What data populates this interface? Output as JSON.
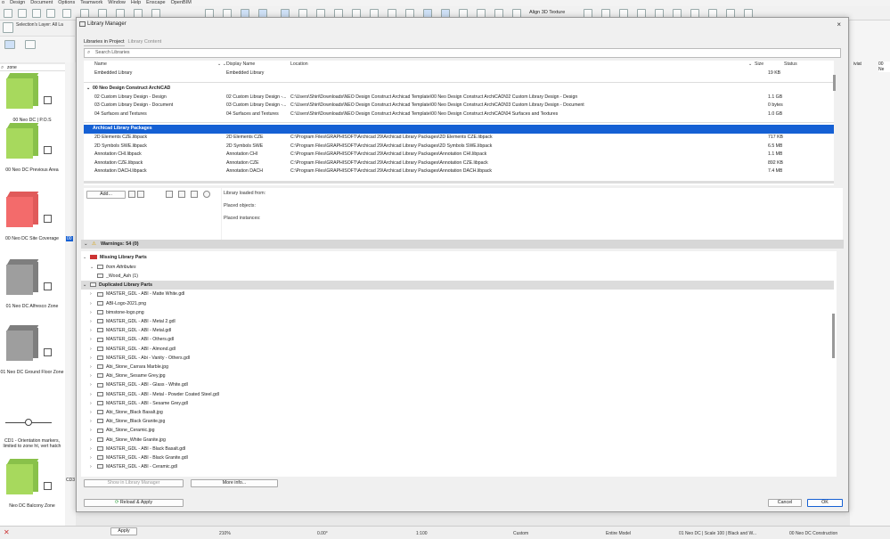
{
  "menu": [
    "o",
    "Design",
    "Document",
    "Options",
    "Teamwork",
    "Window",
    "Help",
    "Enscape",
    "OpenBIM"
  ],
  "toolbar": {
    "align_label": "Align 3D Texture"
  },
  "left": {
    "selection_label": "Selection's Layer:",
    "layer_label": "All La",
    "search_text": "zone",
    "items": [
      {
        "label": "00 Neo DC | P.O.S",
        "color": "#a7d95d",
        "side": "#89c14a"
      },
      {
        "label": "00 Neo DC Previous Area",
        "color": "#a7d95d",
        "side": "#89c14a"
      },
      {
        "label": "00 Neo DC Site Coverage",
        "color": "#f36b6b",
        "side": "#e05a5a"
      },
      {
        "label": "01 Neo DC Alfresco Zone",
        "color": "#9e9e9e",
        "side": "#7e7e7e"
      },
      {
        "label": "01 Neo DC Ground Floor Zone",
        "color": "#9e9e9e",
        "side": "#7e7e7e"
      },
      {
        "label": "CD1 - Orientation markers, limited to zone ht, vert hatch",
        "color": "",
        "side": ""
      },
      {
        "label": "Neo DC Balcony Zone",
        "color": "#a7d95d",
        "side": "#89c14a"
      }
    ],
    "mid_label": "CD3",
    "mid_num": "00"
  },
  "right": {
    "label1": "iviat",
    "label2": "00 Ne"
  },
  "dialog": {
    "title": "Library Manager",
    "close": "×",
    "tabs": [
      "Libraries in Project",
      "Library Content"
    ],
    "search_placeholder": "Search Libraries",
    "columns": {
      "name": "Name",
      "display": "Display Name",
      "location": "Location",
      "size": "Size",
      "status": "Status"
    },
    "rows": [
      {
        "name": "Embedded Library",
        "display": "Embedded Library",
        "location": "",
        "size": "19 KB",
        "style": ""
      },
      {
        "name": "",
        "display": "",
        "location": "",
        "size": "",
        "style": "gap"
      },
      {
        "name": "00 Neo Design Construct ArchiCAD",
        "display": "",
        "location": "",
        "size": "",
        "style": "bold"
      },
      {
        "name": "02 Custom Library Design - Design",
        "display": "02 Custom Library Design -...",
        "location": "C:\\Users\\Shiri\\Downloads\\NEO Design Construct Archicad Template\\00 Neo Design Construct ArchiCAD\\02 Custom Library Design - Design",
        "size": "1.1 GB",
        "style": ""
      },
      {
        "name": "03 Custom Library Design - Document",
        "display": "03 Custom Library Design -...",
        "location": "C:\\Users\\Shiri\\Downloads\\NEO Design Construct Archicad Template\\00 Neo Design Construct ArchiCAD\\03 Custom Library Design - Document",
        "size": "0 bytes",
        "style": ""
      },
      {
        "name": "04 Surfaces and Textures",
        "display": "04 Surfaces and Textures",
        "location": "C:\\Users\\Shiri\\Downloads\\NEO Design Construct Archicad Template\\00 Neo Design Construct ArchiCAD\\04 Surfaces and Textures",
        "size": "1.0 GB",
        "style": ""
      },
      {
        "name": "",
        "display": "",
        "location": "",
        "size": "",
        "style": "gap"
      },
      {
        "name": "Archicad Library Packages",
        "display": "",
        "location": "",
        "size": "",
        "style": "sel"
      },
      {
        "name": "2D Elements CZE.libpack",
        "display": "2D Elements CZE",
        "location": "C:\\Program Files\\GRAPHISOFT\\Archicad 29\\Archicad Library Packages\\2D Elements CZE.libpack",
        "size": "717 KB",
        "style": ""
      },
      {
        "name": "2D Symbols SWE.libpack",
        "display": "2D Symbols SWE",
        "location": "C:\\Program Files\\GRAPHISOFT\\Archicad 29\\Archicad Library Packages\\2D Symbols SWE.libpack",
        "size": "6.5 MB",
        "style": ""
      },
      {
        "name": "Annotation CHI.libpack",
        "display": "Annotation CHI",
        "location": "C:\\Program Files\\GRAPHISOFT\\Archicad 29\\Archicad Library Packages\\Annotation CHI.libpack",
        "size": "1.1 MB",
        "style": ""
      },
      {
        "name": "Annotation CZE.libpack",
        "display": "Annotation CZE",
        "location": "C:\\Program Files\\GRAPHISOFT\\Archicad 29\\Archicad Library Packages\\Annotation CZE.libpack",
        "size": "892 KB",
        "style": ""
      },
      {
        "name": "Annotation DACH.libpack",
        "display": "Annotation DACH",
        "location": "C:\\Program Files\\GRAPHISOFT\\Archicad 29\\Archicad Library Packages\\Annotation DACH.libpack",
        "size": "7.4 MB",
        "style": ""
      }
    ],
    "add_label": "Add...",
    "info": {
      "loaded": "Library loaded from:",
      "placed_objects": "Placed objects:",
      "placed_instances": "Placed instances:"
    },
    "warnings": "Warnings: 54 (0)",
    "tree": [
      {
        "label": "Missing Library Parts",
        "indent": 0,
        "kind": "hdr-red"
      },
      {
        "label": "from Attributes",
        "indent": 1,
        "kind": "italic"
      },
      {
        "label": "_Wood_Ash (1)",
        "indent": 2,
        "kind": "doc"
      },
      {
        "label": "Duplicated Library Parts",
        "indent": 0,
        "kind": "hdr"
      },
      {
        "label": "MASTER_GDL - ABI - Matte White.gdl",
        "indent": 1,
        "kind": "doc"
      },
      {
        "label": "ABI-Logo-2021.png",
        "indent": 1,
        "kind": "doc"
      },
      {
        "label": "bimstone-logo.png",
        "indent": 1,
        "kind": "doc"
      },
      {
        "label": "MASTER_GDL - ABI - Metal 2.gdl",
        "indent": 1,
        "kind": "doc"
      },
      {
        "label": "MASTER_GDL - ABI - Metal.gdl",
        "indent": 1,
        "kind": "doc"
      },
      {
        "label": "MASTER_GDL - ABI - Others.gdl",
        "indent": 1,
        "kind": "doc"
      },
      {
        "label": "MASTER_GDL - ABI - Almond.gdl",
        "indent": 1,
        "kind": "doc"
      },
      {
        "label": "MASTER_GDL - Abi - Vanity - Others.gdl",
        "indent": 1,
        "kind": "doc"
      },
      {
        "label": "Abi_Stone_Carrara Marble.jpg",
        "indent": 1,
        "kind": "doc"
      },
      {
        "label": "Abi_Stone_Sesame Grey.jpg",
        "indent": 1,
        "kind": "doc"
      },
      {
        "label": "MASTER_GDL - ABI - Glass - White.gdl",
        "indent": 1,
        "kind": "doc"
      },
      {
        "label": "MASTER_GDL - ABI - Metal - Powder Coated Steel.gdl",
        "indent": 1,
        "kind": "doc"
      },
      {
        "label": "MASTER_GDL - ABI - Sesame Grey.gdl",
        "indent": 1,
        "kind": "doc"
      },
      {
        "label": "Abi_Stone_Black Basalt.jpg",
        "indent": 1,
        "kind": "doc"
      },
      {
        "label": "Abi_Stone_Black Granite.jpg",
        "indent": 1,
        "kind": "doc"
      },
      {
        "label": "Abi_Stone_Ceramic.jpg",
        "indent": 1,
        "kind": "doc"
      },
      {
        "label": "Abi_Stone_White Granite.jpg",
        "indent": 1,
        "kind": "doc"
      },
      {
        "label": "MASTER_GDL - ABI - Black Basalt.gdl",
        "indent": 1,
        "kind": "doc"
      },
      {
        "label": "MASTER_GDL - ABI - Black Granite.gdl",
        "indent": 1,
        "kind": "doc"
      },
      {
        "label": "MASTER_GDL - ABI - Ceramic.gdl",
        "indent": 1,
        "kind": "doc"
      }
    ],
    "show_in_manager": "Show in Library Manager",
    "more_info": "More info...",
    "reload": "Reload & Apply",
    "cancel": "Cancel",
    "ok": "OK"
  },
  "status": {
    "apply": "Apply",
    "zoom": "210%",
    "angle": "0.00°",
    "scale": "1:100",
    "custom": "Custom",
    "model": "Entire Model",
    "view": "01 Neo DC | Scale 100 | Black and W...",
    "construction": "00 Neo DC Construction"
  }
}
